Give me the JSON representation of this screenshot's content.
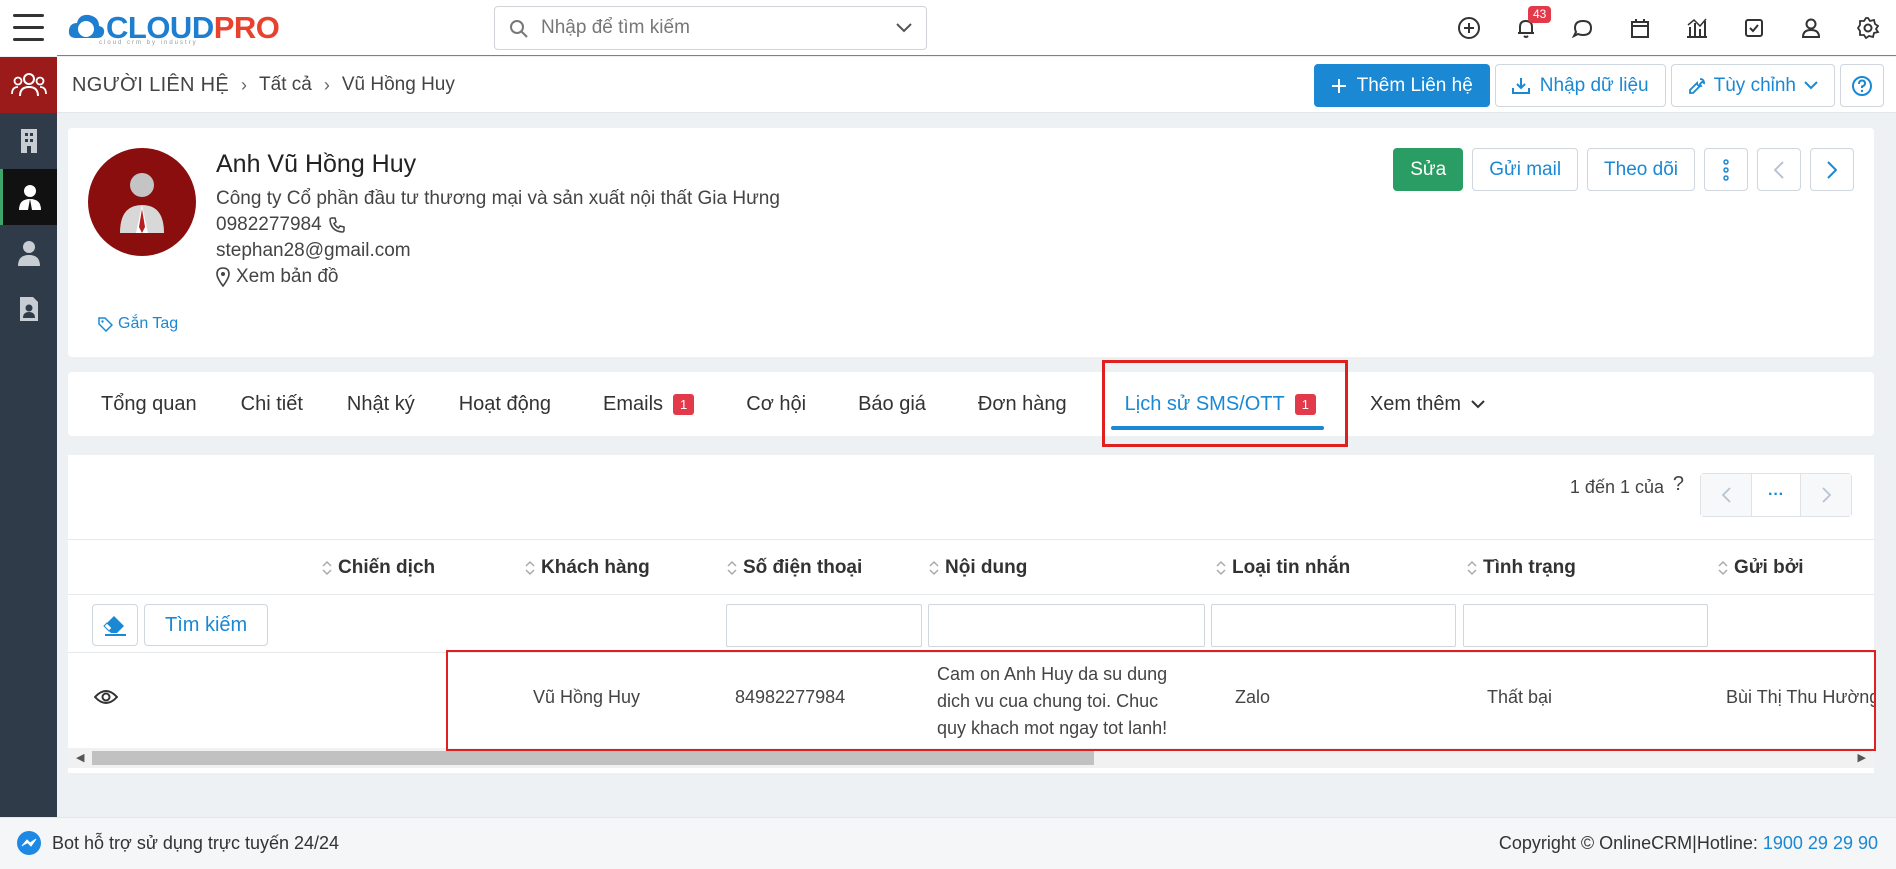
{
  "header": {
    "logo_main": "CLOUD",
    "logo_accent": "PRO",
    "logo_tagline": "cloud crm by industry",
    "search_placeholder": "Nhập để tìm kiếm",
    "notification_count": "43"
  },
  "breadcrumb": {
    "root": "NGƯỜI LIÊN HỆ",
    "level1": "Tất cả",
    "current": "Vũ Hồng Huy"
  },
  "page_actions": {
    "add_contact": "Thêm Liên hệ",
    "import_data": "Nhập dữ liệu",
    "customize": "Tùy chỉnh"
  },
  "profile": {
    "name": "Anh Vũ Hồng Huy",
    "company": "Công ty Cổ phần đầu tư thương mại và sản xuất nội thất Gia Hưng",
    "phone": "0982277984",
    "email": "stephan28@gmail.com",
    "map_link": "Xem bản đồ",
    "tag_link": "Gắn Tag",
    "edit": "Sửa",
    "send_mail": "Gửi mail",
    "follow": "Theo dõi"
  },
  "tabs": [
    {
      "label": "Tổng quan",
      "badge": ""
    },
    {
      "label": "Chi tiết",
      "badge": ""
    },
    {
      "label": "Nhật ký",
      "badge": ""
    },
    {
      "label": "Hoạt động",
      "badge": ""
    },
    {
      "label": "Emails",
      "badge": "1"
    },
    {
      "label": "Cơ hội",
      "badge": ""
    },
    {
      "label": "Báo giá",
      "badge": ""
    },
    {
      "label": "Đơn hàng",
      "badge": ""
    },
    {
      "label": "Lịch sử SMS/OTT",
      "badge": "1"
    },
    {
      "label": "Xem thêm",
      "badge": ""
    }
  ],
  "table": {
    "pager_text": "1 đến 1 của",
    "pager_help": "?",
    "pager_more": "···",
    "search_button": "Tìm kiếm",
    "columns": [
      "Chiến dịch",
      "Khách hàng",
      "Số điện thoại",
      "Nội dung",
      "Loại tin nhắn",
      "Tình trạng",
      "Gửi bởi"
    ],
    "rows": [
      {
        "campaign": "",
        "customer": "Vũ Hồng Huy",
        "phone": "84982277984",
        "content_line1": "Cam on Anh Huy da su dung",
        "content_line2": "dich vu cua chung toi. Chuc",
        "content_line3": "quy khach mot ngay tot lanh!",
        "message_type": "Zalo",
        "status": "Thất bại",
        "sent_by": "Bùi Thị Thu Hường"
      }
    ]
  },
  "footer": {
    "bot_text": "Bot hỗ trợ sử dụng trực tuyến 24/24",
    "copyright": "Copyright © OnlineCRM|Hotline: ",
    "hotline": "1900 29 29 90"
  },
  "colors": {
    "primary": "#1a88d3",
    "success": "#2a9d64",
    "danger": "#e23a4a",
    "sidebar": "#2f3b48"
  }
}
